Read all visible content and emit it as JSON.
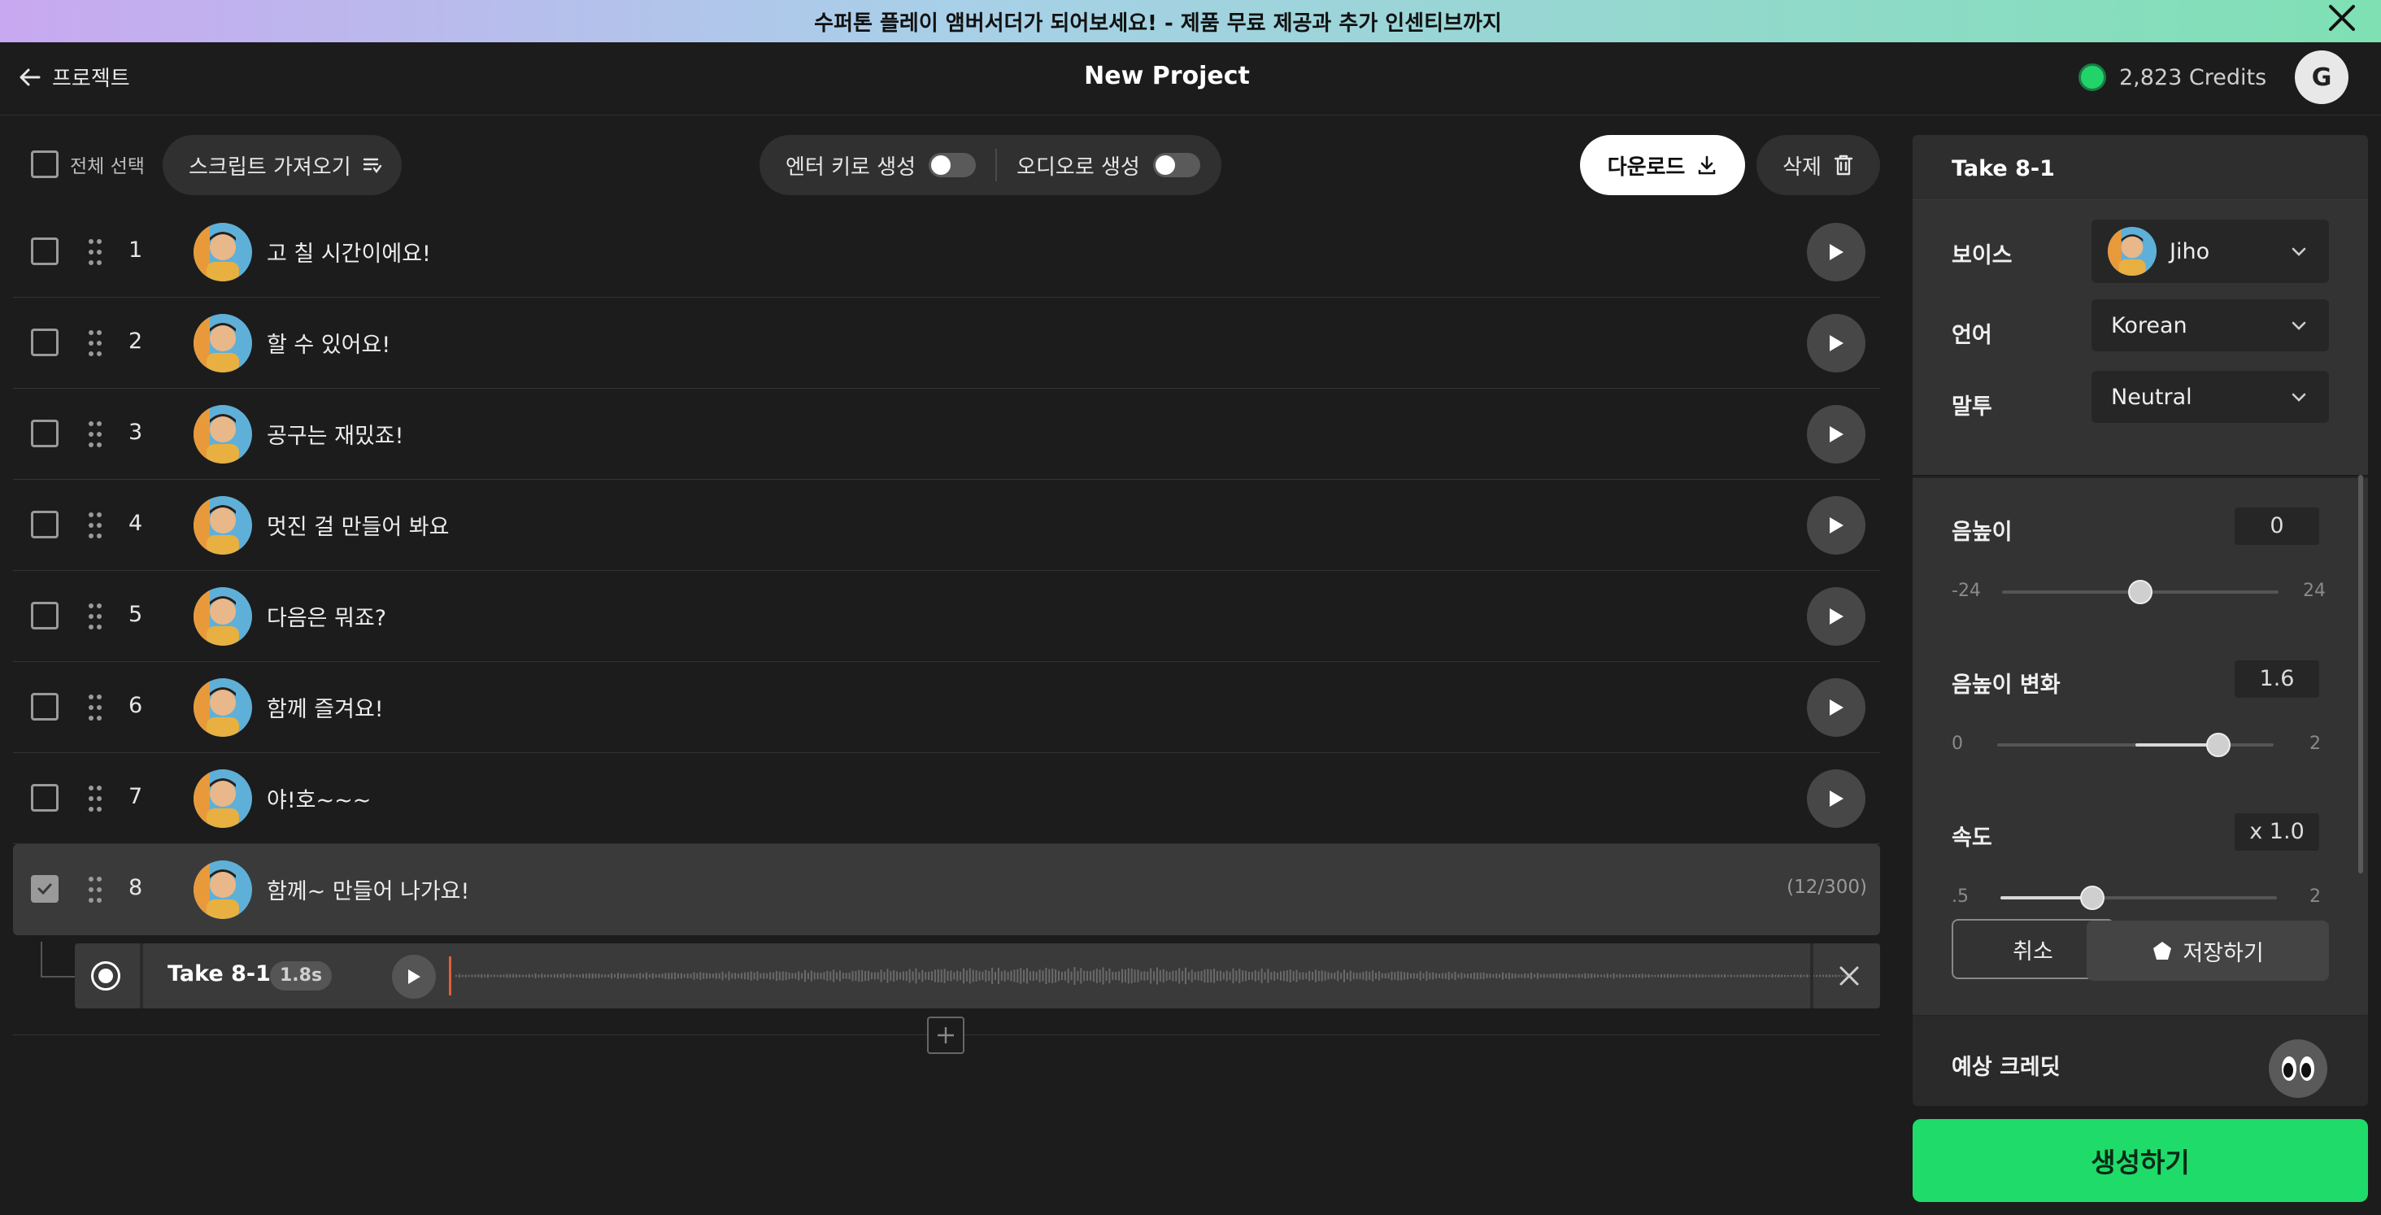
{
  "banner": {
    "text": "수퍼톤 플레이 앰버서더가 되어보세요! - 제품 무료 제공과 추가 인센티브까지"
  },
  "header": {
    "back_label": "프로젝트",
    "title": "New Project",
    "credits": "2,823 Credits",
    "user_initial": "G"
  },
  "toolbar": {
    "select_all": "전체 선택",
    "import_script": "스크립트 가져오기",
    "enter_generate": "엔터 키로 생성",
    "audio_generate": "오디오로 생성",
    "download": "다운로드",
    "delete": "삭제"
  },
  "lines": [
    {
      "num": "1",
      "text": "고 칠 시간이에요!"
    },
    {
      "num": "2",
      "text": "할 수 있어요!"
    },
    {
      "num": "3",
      "text": "공구는 재밌죠!"
    },
    {
      "num": "4",
      "text": "멋진 걸 만들어 봐요"
    },
    {
      "num": "5",
      "text": "다음은 뭐죠?"
    },
    {
      "num": "6",
      "text": "함께 즐겨요!"
    },
    {
      "num": "7",
      "text": "야!호~~~"
    },
    {
      "num": "8",
      "text": "함께~ 만들어 나가요!",
      "count": "(12/300)",
      "selected": true
    }
  ],
  "take": {
    "name": "Take 8-1",
    "duration": "1.8s"
  },
  "panel": {
    "title": "Take 8-1",
    "voice_label": "보이스",
    "voice_value": "Jiho",
    "language_label": "언어",
    "language_value": "Korean",
    "tone_label": "말투",
    "tone_value": "Neutral",
    "pitch": {
      "label": "음높이",
      "value": "0",
      "min": "-24",
      "max": "24",
      "level": 0.5
    },
    "pitch_var": {
      "label": "음높이 변화",
      "value": "1.6",
      "min": "0",
      "max": "2",
      "level": 0.8
    },
    "speed": {
      "label": "속도",
      "value": "x 1.0",
      "min": ".5",
      "max": "2",
      "level": 0.333
    },
    "cancel": "취소",
    "save": "저장하기",
    "estimate_label": "예상 크레딧"
  },
  "generate": "생성하기",
  "colors": {
    "accent_green": "#1fdc6a",
    "credit_dot": "#22d36a",
    "take_marker": "#e0603a"
  }
}
